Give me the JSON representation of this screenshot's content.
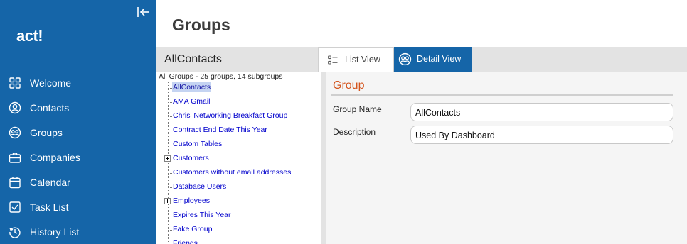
{
  "sidebar": {
    "logo": "act!",
    "collapse_icon": "collapse-left-icon",
    "items": [
      {
        "label": "Welcome",
        "icon": "grid-icon"
      },
      {
        "label": "Contacts",
        "icon": "person-icon"
      },
      {
        "label": "Groups",
        "icon": "group-icon"
      },
      {
        "label": "Companies",
        "icon": "briefcase-icon"
      },
      {
        "label": "Calendar",
        "icon": "calendar-icon"
      },
      {
        "label": "Task List",
        "icon": "checkbox-icon"
      },
      {
        "label": "History List",
        "icon": "history-icon"
      }
    ]
  },
  "page": {
    "title": "Groups"
  },
  "toolbar": {
    "selected_group": "AllContacts",
    "tabs": [
      {
        "label": "List View",
        "icon": "list-icon",
        "active": false
      },
      {
        "label": "Detail View",
        "icon": "group-icon",
        "active": true
      }
    ]
  },
  "tree": {
    "header": "All Groups - 25 groups, 14 subgroups",
    "items": [
      {
        "label": "AllContacts",
        "selected": true,
        "expandable": false
      },
      {
        "label": "AMA Gmail",
        "selected": false,
        "expandable": false
      },
      {
        "label": "Chris' Networking Breakfast Group",
        "selected": false,
        "expandable": false
      },
      {
        "label": "Contract End Date This Year",
        "selected": false,
        "expandable": false
      },
      {
        "label": "Custom Tables",
        "selected": false,
        "expandable": false
      },
      {
        "label": "Customers",
        "selected": false,
        "expandable": true
      },
      {
        "label": "Customers without email addresses",
        "selected": false,
        "expandable": false
      },
      {
        "label": "Database Users",
        "selected": false,
        "expandable": false
      },
      {
        "label": "Employees",
        "selected": false,
        "expandable": true
      },
      {
        "label": "Expires This Year",
        "selected": false,
        "expandable": false
      },
      {
        "label": "Fake Group",
        "selected": false,
        "expandable": false
      },
      {
        "label": "Friends",
        "selected": false,
        "expandable": false
      }
    ]
  },
  "detail": {
    "section_title": "Group",
    "fields": [
      {
        "label": "Group Name",
        "value": "AllContacts"
      },
      {
        "label": "Description",
        "value": "Used By Dashboard"
      }
    ]
  },
  "colors": {
    "sidebar_bg": "#1565a8",
    "section_title": "#d4541c",
    "link": "#0000cc",
    "selection": "#c5d4f2"
  }
}
